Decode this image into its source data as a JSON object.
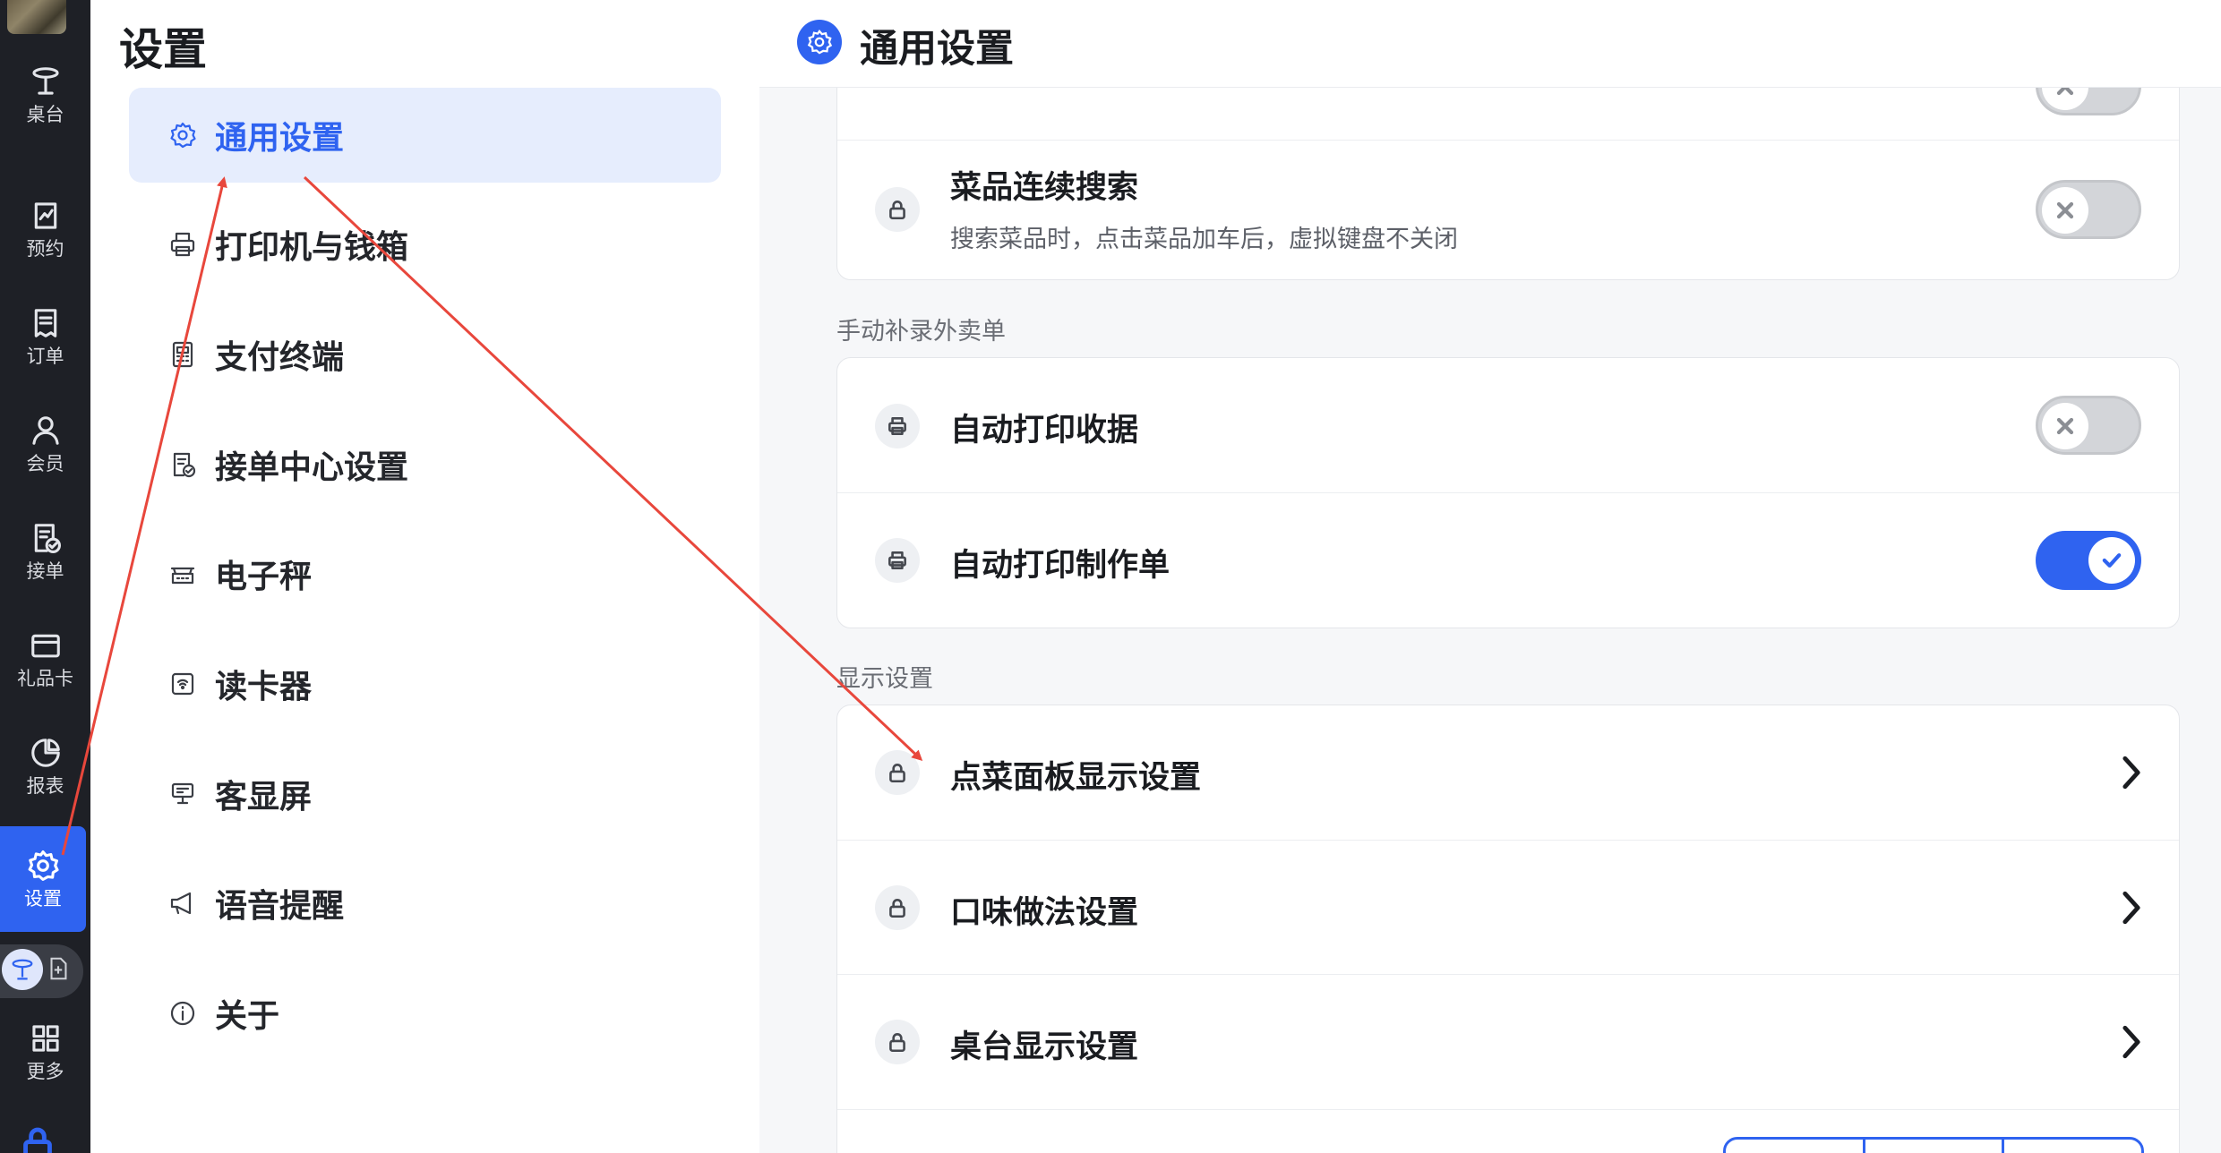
{
  "rail": {
    "items": [
      {
        "label": "桌台",
        "icon": "table-icon"
      },
      {
        "label": "预约",
        "icon": "reservation-icon"
      },
      {
        "label": "订单",
        "icon": "order-icon"
      },
      {
        "label": "会员",
        "icon": "member-icon"
      },
      {
        "label": "接单",
        "icon": "accept-order-icon"
      },
      {
        "label": "礼品卡",
        "icon": "gift-card-icon"
      },
      {
        "label": "报表",
        "icon": "report-icon"
      },
      {
        "label": "设置",
        "icon": "gear-icon",
        "active": true
      },
      {
        "label": "更多",
        "icon": "grid-icon"
      }
    ]
  },
  "menu": {
    "title": "设置",
    "items": [
      {
        "label": "通用设置",
        "icon": "gear-icon",
        "active": true
      },
      {
        "label": "打印机与钱箱",
        "icon": "printer-icon"
      },
      {
        "label": "支付终端",
        "icon": "payment-terminal-icon"
      },
      {
        "label": "接单中心设置",
        "icon": "order-center-icon"
      },
      {
        "label": "电子秤",
        "icon": "scale-icon"
      },
      {
        "label": "读卡器",
        "icon": "card-reader-icon"
      },
      {
        "label": "客显屏",
        "icon": "customer-display-icon"
      },
      {
        "label": "语音提醒",
        "icon": "megaphone-icon"
      },
      {
        "label": "关于",
        "icon": "info-icon"
      }
    ]
  },
  "content": {
    "header_title": "通用设置",
    "search_row": {
      "title": "菜品连续搜索",
      "subtitle": "搜索菜品时，点击菜品加车后，虚拟键盘不关闭",
      "enabled": false
    },
    "section_takeout": "手动补录外卖单",
    "takeout_rows": [
      {
        "title": "自动打印收据",
        "enabled": false
      },
      {
        "title": "自动打印制作单",
        "enabled": true
      }
    ],
    "section_display": "显示设置",
    "display_rows": [
      {
        "title": "点菜面板显示设置"
      },
      {
        "title": "口味做法设置"
      },
      {
        "title": "桌台显示设置"
      }
    ]
  },
  "colors": {
    "accent": "#2f63f0",
    "rail_bg": "#1e2026",
    "annotation_arrow": "#e8473c"
  }
}
